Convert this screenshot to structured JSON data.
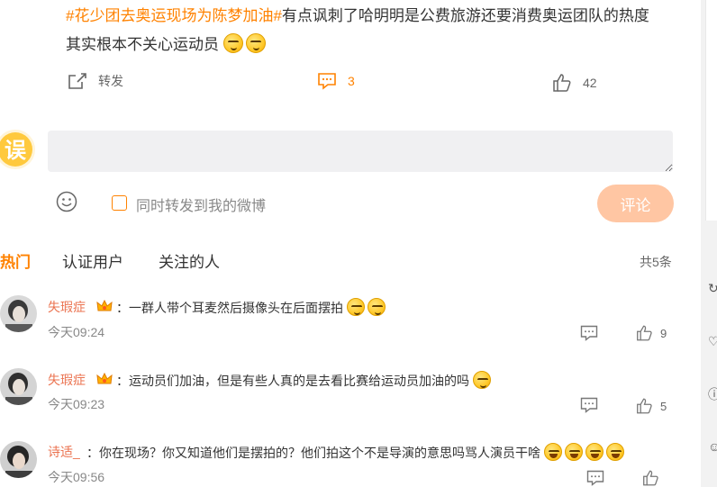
{
  "post": {
    "topic": "#花少团去奥运现场为陈梦加油#",
    "text_line1": "有点讽刺了哈明明是公费旅游还要消费奥运团队的热度",
    "text_line2": "其实根本不关心运动员",
    "emoji_icons": [
      "smirk-emoji",
      "smirk-emoji"
    ]
  },
  "actions": {
    "forward_label": "转发",
    "comment_count": "3",
    "like_count": "42"
  },
  "composer": {
    "avatar_text": "误",
    "input_value": "",
    "repost_label": "同时转发到我的微博",
    "submit_label": "评论",
    "emoji_icon": "smiley-face-icon"
  },
  "tabs": {
    "hot": "热门",
    "verified": "认证用户",
    "following": "关注的人",
    "total": "共5条"
  },
  "comments": [
    {
      "user": "失瑕症",
      "sep": "：",
      "text": "一群人带个耳麦然后摄像头在后面摆拍",
      "emojis": 2,
      "time": "今天09:24",
      "likes": "9"
    },
    {
      "user": "失瑕症",
      "sep": "：",
      "text": "运动员们加油，但是有些人真的是去看比赛给运动员加油的吗",
      "emojis": 1,
      "time": "今天09:23",
      "likes": "5"
    },
    {
      "user": "诗适_",
      "sep": "：",
      "text": "你在现场？你又知道他们是摆拍的？他们拍这个不是导演的意思吗骂人演员干啥",
      "emojis": 4,
      "time": "今天09:56",
      "likes": ""
    }
  ],
  "colors": {
    "accent": "#ff8200",
    "username": "#eb7350",
    "submit_disabled": "#ffc6a3",
    "input_bg": "#f0f0f2"
  }
}
